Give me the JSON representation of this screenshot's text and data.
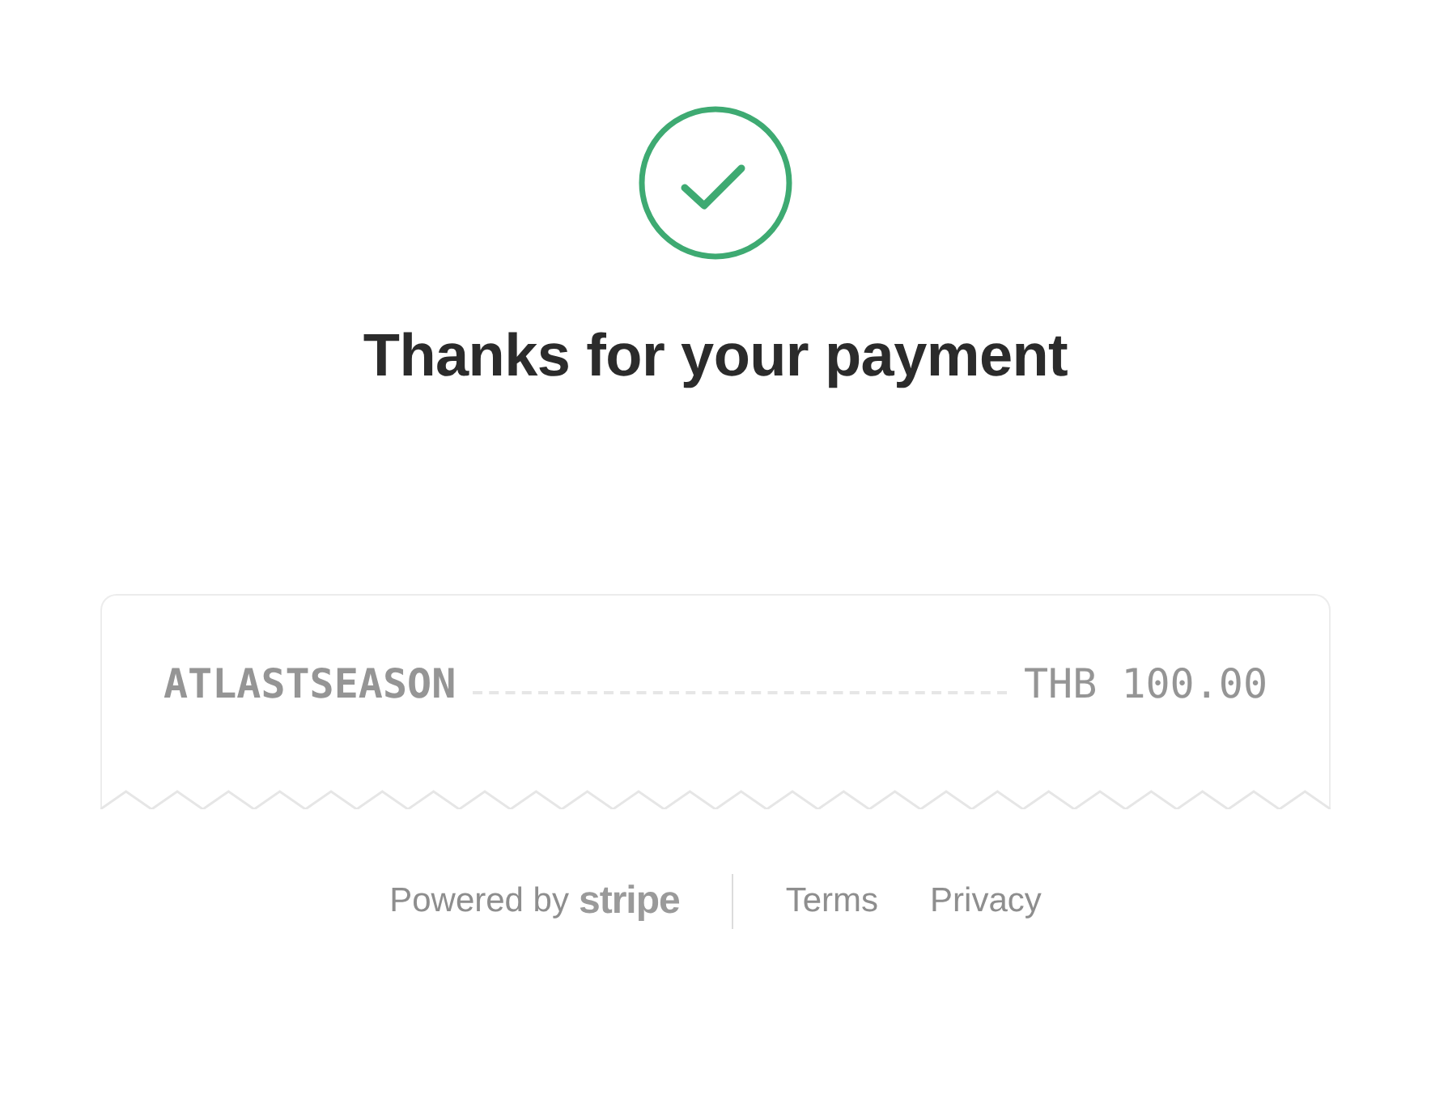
{
  "heading": "Thanks for your payment",
  "receipt": {
    "item": "ATLASTSEASON",
    "amount": "THB 100.00"
  },
  "footer": {
    "powered_by": "Powered by",
    "brand": "stripe",
    "links": [
      "Terms",
      "Privacy"
    ]
  }
}
